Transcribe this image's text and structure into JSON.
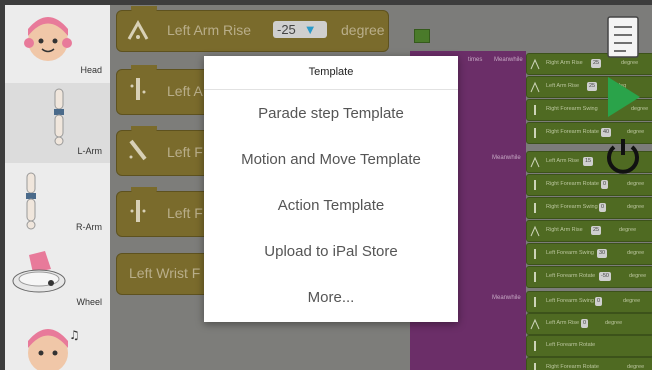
{
  "sidebar": {
    "categories": [
      {
        "label": "Head",
        "icon": "robot-head-icon"
      },
      {
        "label": "L-Arm",
        "icon": "left-arm-icon"
      },
      {
        "label": "R-Arm",
        "icon": "right-arm-icon"
      },
      {
        "label": "Wheel",
        "icon": "wheel-icon"
      },
      {
        "label": "",
        "icon": "music-head-icon"
      }
    ]
  },
  "palette": {
    "blocks": [
      {
        "label": "Left Arm Rise",
        "value": "-25",
        "unit": "degree"
      },
      {
        "label": "Left A"
      },
      {
        "label": "Left F"
      },
      {
        "label": "Left F"
      },
      {
        "label": "Left Wrist F"
      }
    ]
  },
  "workspace": {
    "loops": [
      {
        "label": "Meanwhile"
      },
      {
        "label": "Meanwhile"
      },
      {
        "label": "Meanwhile"
      }
    ],
    "extra_label": "times",
    "blocks": [
      {
        "label": "Right Arm Rise",
        "value": "25",
        "unit": "degree"
      },
      {
        "label": "Left Arm Rise",
        "value": "25",
        "unit": "deg"
      },
      {
        "label": "Right Forearm Swing",
        "value": "",
        "unit": "degree"
      },
      {
        "label": "Right Forearm Rotate",
        "value": "40",
        "unit": "degree"
      },
      {
        "label": "Left Arm Rise",
        "value": "15",
        "unit": ""
      },
      {
        "label": "Right Forearm Rotate",
        "value": "0",
        "unit": "degree"
      },
      {
        "label": "Right Forearm Swing",
        "value": "0",
        "unit": "degree"
      },
      {
        "label": "Right Arm Rise",
        "value": "25",
        "unit": "degree"
      },
      {
        "label": "Left Forearm Swing",
        "value": "30",
        "unit": "degree"
      },
      {
        "label": "Left Forearm Rotate",
        "value": "-50",
        "unit": "degree"
      },
      {
        "label": "Left Forearm Swing",
        "value": "0",
        "unit": "degree"
      },
      {
        "label": "Left Arm Rise",
        "value": "0",
        "unit": "degree"
      },
      {
        "label": "Left Forearm Rotate",
        "value": "",
        "unit": ""
      },
      {
        "label": "Right Forearm Rotate",
        "value": "",
        "unit": "degree"
      }
    ]
  },
  "modal": {
    "title": "Template",
    "options": [
      "Parade step Template",
      "Motion and Move Template",
      "Action Template",
      "Upload to iPal Store",
      "More..."
    ]
  },
  "icons": [
    "notes-icon",
    "play-icon",
    "power-icon",
    "flag-icon"
  ],
  "colors": {
    "palette_block": "#7a6b2c",
    "workspace_block": "#4f6a22",
    "loop": "#6b2e68",
    "play": "#2aa34a"
  }
}
